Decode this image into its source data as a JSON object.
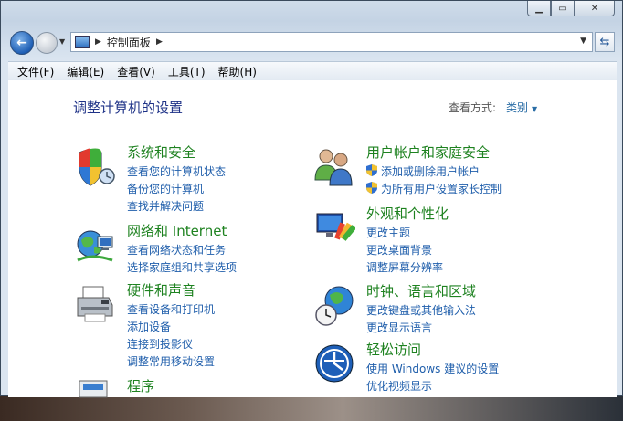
{
  "window": {
    "title_buttons": [
      "minimize",
      "maximize",
      "close"
    ]
  },
  "address": {
    "breadcrumb": "控制面板",
    "refresh_icon": "refresh-icon"
  },
  "menu": [
    "文件(F)",
    "编辑(E)",
    "查看(V)",
    "工具(T)",
    "帮助(H)"
  ],
  "page": {
    "title": "调整计算机的设置",
    "view_by_label": "查看方式:",
    "view_by_value": "类别"
  },
  "categories": [
    {
      "title": "系统和安全",
      "icon": "security-shield-icon",
      "links": [
        "查看您的计算机状态",
        "备份您的计算机",
        "查找并解决问题"
      ]
    },
    {
      "title": "网络和 Internet",
      "icon": "network-globe-icon",
      "links": [
        "查看网络状态和任务",
        "选择家庭组和共享选项"
      ]
    },
    {
      "title": "硬件和声音",
      "icon": "printer-icon",
      "links": [
        "查看设备和打印机",
        "添加设备",
        "连接到投影仪",
        "调整常用移动设置"
      ]
    },
    {
      "title": "程序",
      "icon": "programs-icon",
      "links": []
    },
    {
      "title": "用户帐户和家庭安全",
      "icon": "users-icon",
      "links": [
        "添加或删除用户帐户",
        "为所有用户设置家长控制"
      ]
    },
    {
      "title": "外观和个性化",
      "icon": "appearance-icon",
      "links": [
        "更改主题",
        "更改桌面背景",
        "调整屏幕分辨率"
      ]
    },
    {
      "title": "时钟、语言和区域",
      "icon": "clock-globe-icon",
      "links": [
        "更改键盘或其他输入法",
        "更改显示语言"
      ]
    },
    {
      "title": "轻松访问",
      "icon": "ease-of-access-icon",
      "links": [
        "使用 Windows 建议的设置",
        "优化视频显示"
      ]
    }
  ]
}
